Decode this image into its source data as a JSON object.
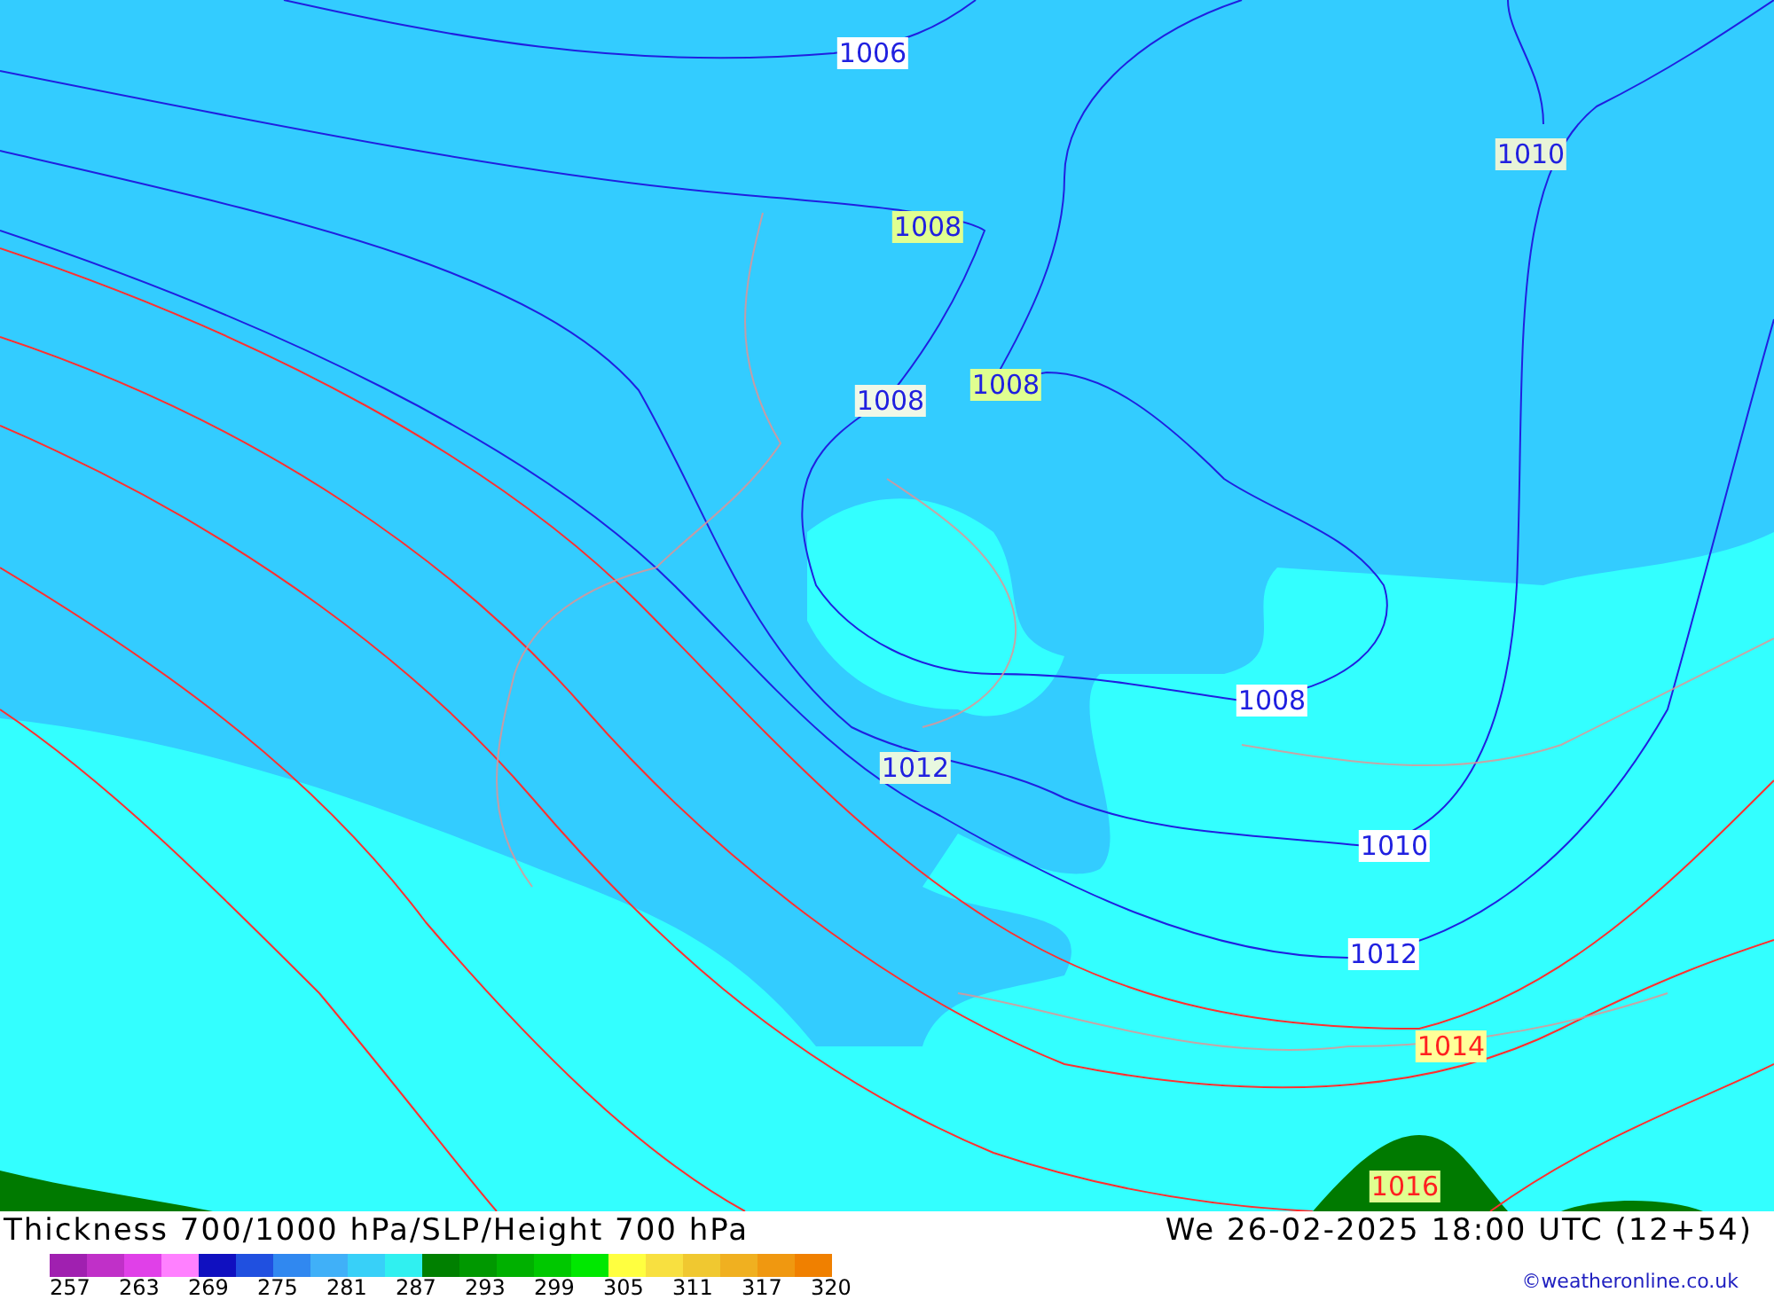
{
  "map": {
    "isobar_labels": [
      {
        "text": "1006",
        "kind": "cold",
        "color": "#ffffff"
      },
      {
        "text": "1010",
        "kind": "cold",
        "color": "#e8f4d8"
      },
      {
        "text": "1008",
        "kind": "cold",
        "color": "#e0ff90"
      },
      {
        "text": "1008",
        "kind": "cold",
        "color": "#f0f8e8"
      },
      {
        "text": "1008",
        "kind": "cold",
        "color": "#e0ff90"
      },
      {
        "text": "1008",
        "kind": "cold",
        "color": "#ffffff"
      },
      {
        "text": "1012",
        "kind": "cold",
        "color": "#e8f8e0"
      },
      {
        "text": "1010",
        "kind": "cold",
        "color": "#ffffff"
      },
      {
        "text": "1012",
        "kind": "cold",
        "color": "#ffffff"
      },
      {
        "text": "1014",
        "kind": "warm",
        "color": "#ffff99"
      },
      {
        "text": "1016",
        "kind": "warm",
        "color": "#e0ff90"
      }
    ]
  },
  "footer": {
    "title": "Thickness 700/1000 hPa/SLP/Height 700 hPa",
    "datetime": "We 26-02-2025 18:00 UTC (12+54)",
    "credit": "©weatheronline.co.uk",
    "legend": {
      "swatches": [
        {
          "color": "#a020b0"
        },
        {
          "color": "#c030c8"
        },
        {
          "color": "#e040e8"
        },
        {
          "color": "#ff80ff"
        },
        {
          "color": "#1010c0"
        },
        {
          "color": "#2050e0"
        },
        {
          "color": "#3088f0"
        },
        {
          "color": "#40b0f8"
        },
        {
          "color": "#38d0f8"
        },
        {
          "color": "#30f0f0"
        },
        {
          "color": "#008000"
        },
        {
          "color": "#009800"
        },
        {
          "color": "#00b000"
        },
        {
          "color": "#00c800"
        },
        {
          "color": "#00e800"
        },
        {
          "color": "#ffff40"
        },
        {
          "color": "#f8e040"
        },
        {
          "color": "#f0c830"
        },
        {
          "color": "#f0b020"
        },
        {
          "color": "#f09810"
        },
        {
          "color": "#f08000"
        }
      ],
      "labels": [
        "257",
        "263",
        "269",
        "275",
        "281",
        "287",
        "293",
        "299",
        "305",
        "311",
        "317",
        "320"
      ]
    }
  }
}
